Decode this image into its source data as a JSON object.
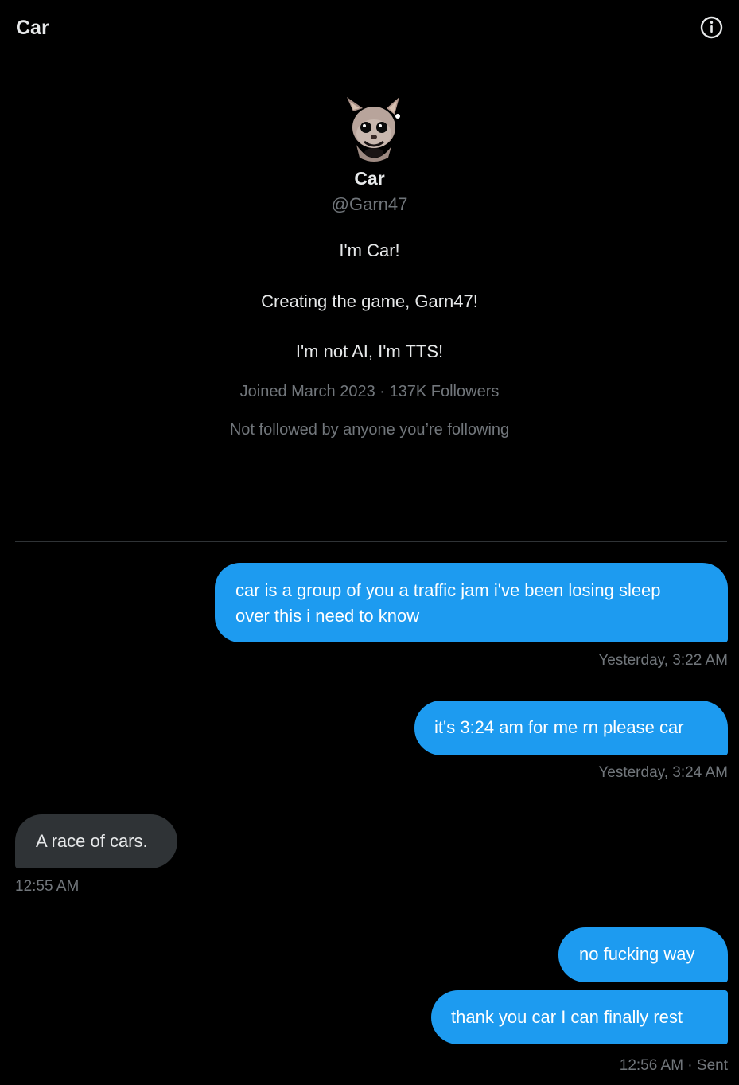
{
  "header": {
    "title": "Car",
    "info_icon": "info-circle-icon"
  },
  "profile": {
    "avatar": "cartoon-cat-avatar",
    "name": "Car",
    "handle": "@Garn47",
    "bio": [
      "I'm Car!",
      "Creating the game, Garn47!",
      "I'm not AI, I'm TTS!"
    ],
    "joined": "Joined March 2023 · 137K Followers",
    "followed_by": "Not followed by anyone you’re following"
  },
  "messages": [
    {
      "direction": "sent",
      "lines": [
        "car is a group of you a traffic jam i've been losing sleep",
        "over this i need to know"
      ],
      "timestamp": "Yesterday, 3:22 AM"
    },
    {
      "direction": "sent",
      "lines": [
        "it's 3:24 am for me rn please car"
      ],
      "timestamp": "Yesterday, 3:24 AM"
    },
    {
      "direction": "received",
      "lines": [
        "A race of cars."
      ],
      "timestamp": "12:55 AM"
    },
    {
      "direction": "sent",
      "lines": [
        "no fucking way"
      ],
      "timestamp": ""
    },
    {
      "direction": "sent",
      "lines": [
        "thank you car I can finally rest"
      ],
      "timestamp": "12:56 AM · Sent"
    }
  ],
  "colors": {
    "background": "#000000",
    "sent_bubble": "#1d9bf0",
    "received_bubble": "#2f3336",
    "muted_text": "#71767b",
    "primary_text": "#e7e9ea"
  }
}
